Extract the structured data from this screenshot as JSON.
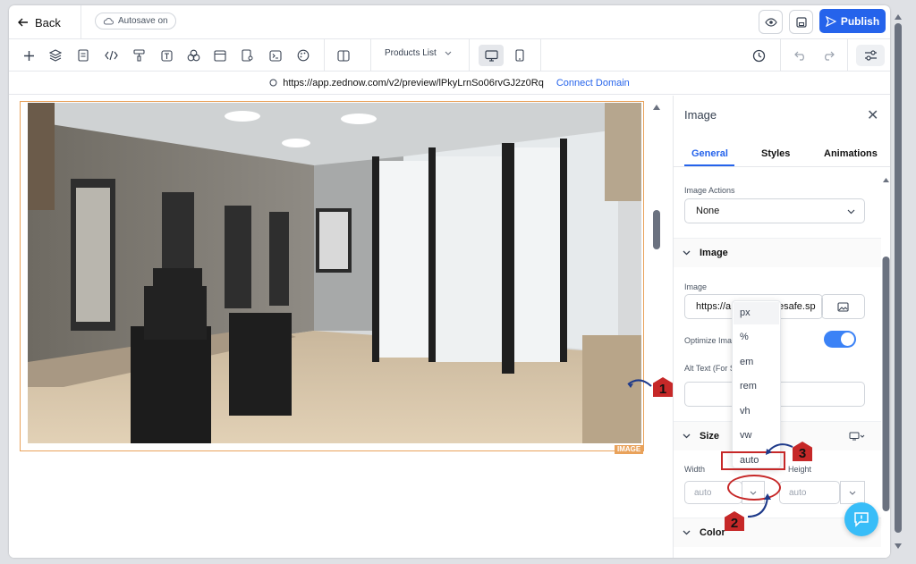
{
  "topbar": {
    "back_label": "Back",
    "autosave_label": "Autosave on",
    "publish_label": "Publish"
  },
  "toolbar": {
    "page_select": "Products List"
  },
  "urlbar": {
    "url": "https://app.zednow.com/v2/preview/lPkyLrnSo06rvGJ2z0Rq",
    "connect_label": "Connect Domain"
  },
  "canvas": {
    "element_badge": "IMAGE"
  },
  "panel": {
    "title": "Image",
    "tabs": [
      {
        "label": "General",
        "active": true
      },
      {
        "label": "Styles",
        "active": false
      },
      {
        "label": "Animations",
        "active": false
      }
    ],
    "image_actions_label": "Image Actions",
    "image_actions_value": "None",
    "image_section_title": "Image",
    "image_field_label": "Image",
    "image_url_value": "https://a",
    "image_url_tail": "esafe.sp",
    "optimize_label": "Optimize Ima",
    "alt_text_label": "Alt Text (For S",
    "size_section_title": "Size",
    "width_label": "Width",
    "height_label": "Height",
    "width_value": "auto",
    "height_value": "auto",
    "color_section_title": "Color"
  },
  "unit_dropdown": {
    "options": [
      "px",
      "%",
      "em",
      "rem",
      "vh",
      "vw",
      "auto"
    ],
    "selected": "auto"
  },
  "annotations": {
    "marker_1": "1",
    "marker_2": "2",
    "marker_3": "3",
    "color": "#c62828"
  },
  "colors": {
    "accent": "#2563eb",
    "selection_border": "#e9a25b",
    "help_button": "#38bdf8"
  }
}
